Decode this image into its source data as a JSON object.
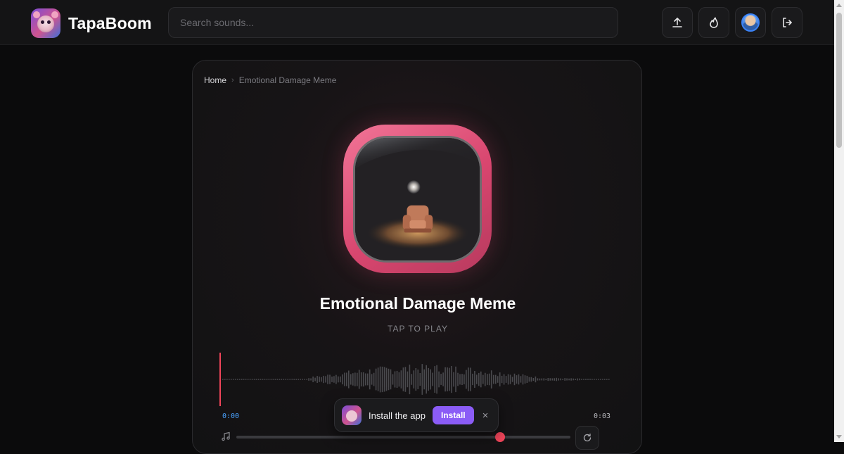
{
  "header": {
    "brand_name": "TapaBoom",
    "search_placeholder": "Search sounds...",
    "buttons": [
      {
        "name": "upload-button",
        "icon": "upload-icon"
      },
      {
        "name": "trending-button",
        "icon": "flame-icon"
      },
      {
        "name": "profile-button",
        "icon": "avatar"
      },
      {
        "name": "logout-button",
        "icon": "logout-icon"
      }
    ]
  },
  "breadcrumb": {
    "home": "Home",
    "separator": "›",
    "current": "Emotional Damage Meme"
  },
  "sound": {
    "title": "Emotional Damage Meme",
    "tap_hint": "TAP TO PLAY",
    "time_current": "0:00",
    "time_total": "0:03",
    "progress": 0,
    "volume": 0.79
  },
  "toast": {
    "text": "Install the app",
    "install_label": "Install",
    "close_label": "×"
  },
  "colors": {
    "accent_pink": "#e04f78",
    "install_purple": "#8b5cf6",
    "playhead": "#f0455a",
    "time_blue": "#4aa3ff"
  }
}
